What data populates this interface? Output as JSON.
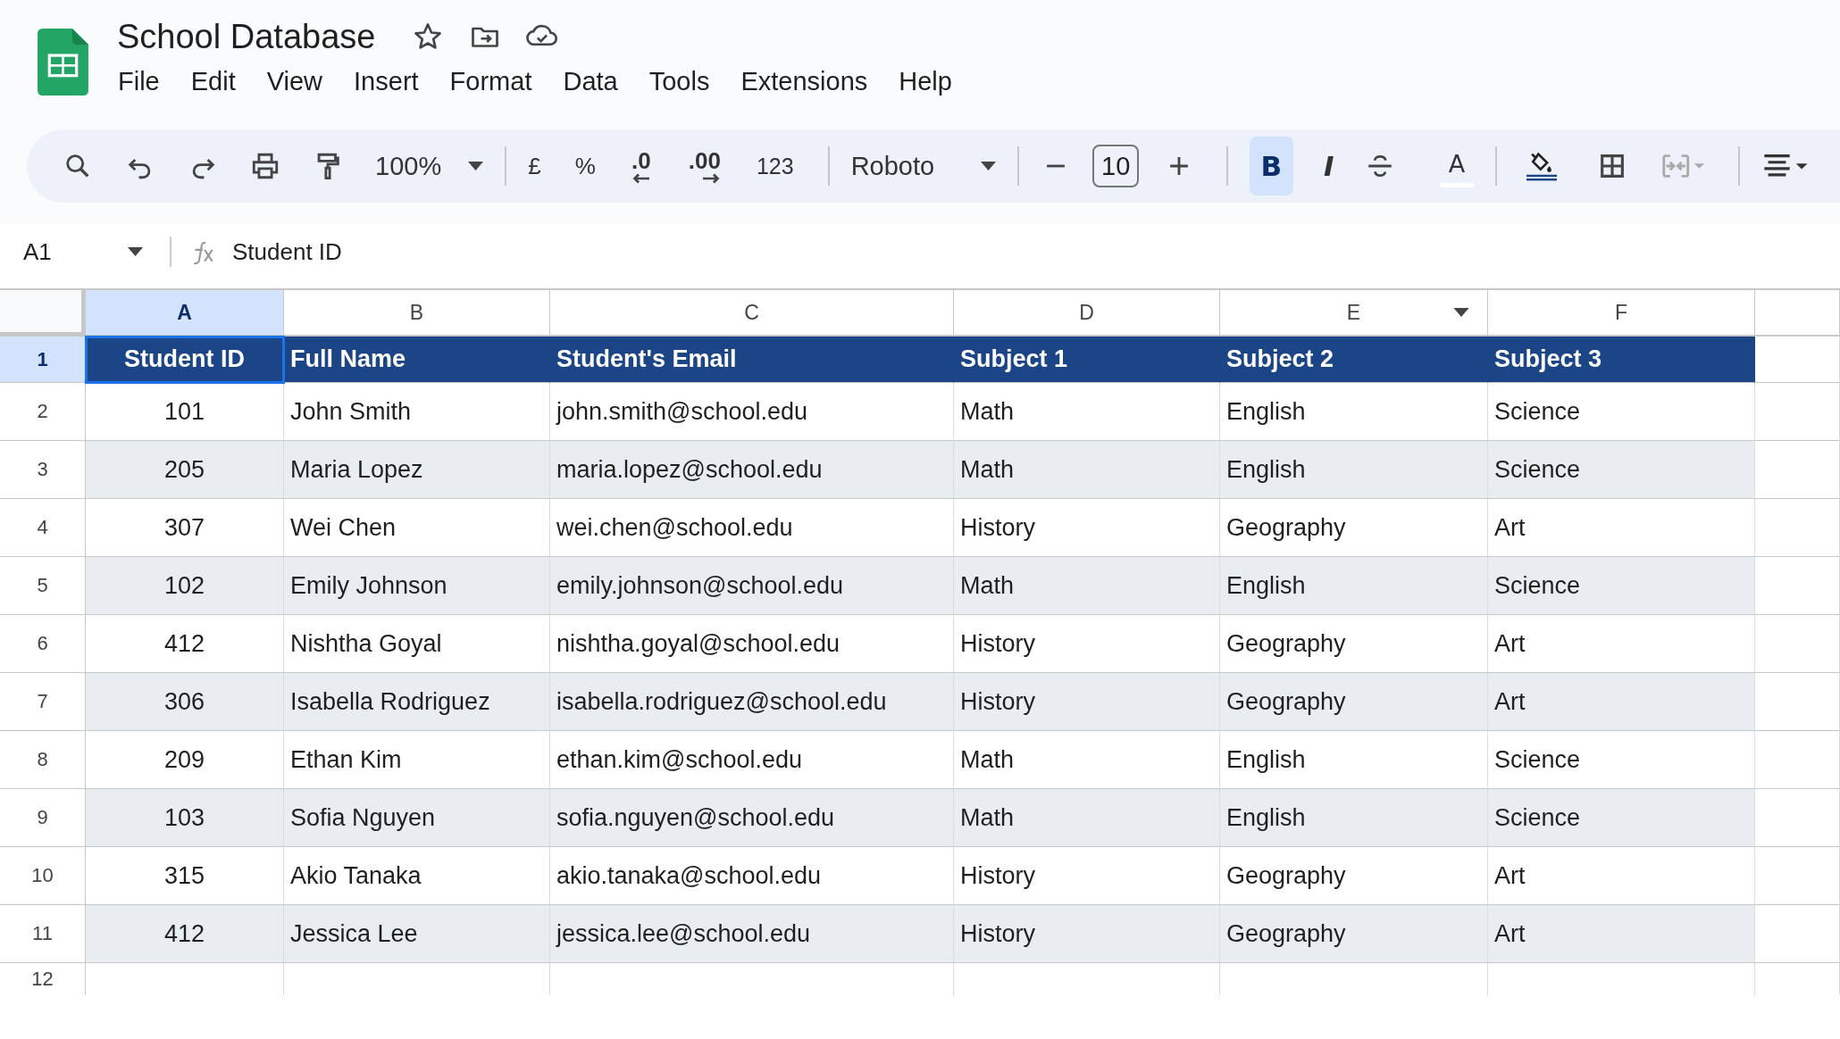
{
  "title": "School Database",
  "menu": [
    "File",
    "Edit",
    "View",
    "Insert",
    "Format",
    "Data",
    "Tools",
    "Extensions",
    "Help"
  ],
  "toolbar": {
    "zoom": "100%",
    "currency": "£",
    "percent": "%",
    "decrease_decimal": ".0",
    "increase_decimal": ".00",
    "number_format": "123",
    "font": "Roboto",
    "font_size": "10",
    "bold": {
      "label": "B",
      "selected": true
    },
    "italic": "I",
    "text_color": "A"
  },
  "name_box": "A1",
  "formula": "Student ID",
  "columns": [
    {
      "letter": "A",
      "selected": true,
      "filter": false
    },
    {
      "letter": "B",
      "selected": false,
      "filter": false
    },
    {
      "letter": "C",
      "selected": false,
      "filter": false
    },
    {
      "letter": "D",
      "selected": false,
      "filter": false
    },
    {
      "letter": "E",
      "selected": false,
      "filter": true
    },
    {
      "letter": "F",
      "selected": false,
      "filter": false
    }
  ],
  "rows": [
    {
      "number": "1",
      "selected": true,
      "kind": "header",
      "cells": [
        "Student ID",
        "Full Name",
        "Student's Email",
        "Subject 1",
        "Subject 2",
        "Subject 3"
      ]
    },
    {
      "number": "2",
      "selected": false,
      "kind": "data",
      "cells": [
        "101",
        "John Smith",
        "john.smith@school.edu",
        "Math",
        "English",
        "Science"
      ]
    },
    {
      "number": "3",
      "selected": false,
      "kind": "data",
      "cells": [
        "205",
        "Maria Lopez",
        "maria.lopez@school.edu",
        "Math",
        "English",
        "Science"
      ]
    },
    {
      "number": "4",
      "selected": false,
      "kind": "data",
      "cells": [
        "307",
        "Wei Chen",
        "wei.chen@school.edu",
        "History",
        "Geography",
        "Art"
      ]
    },
    {
      "number": "5",
      "selected": false,
      "kind": "data",
      "cells": [
        "102",
        "Emily Johnson",
        "emily.johnson@school.edu",
        "Math",
        "English",
        "Science"
      ]
    },
    {
      "number": "6",
      "selected": false,
      "kind": "data",
      "cells": [
        "412",
        "Nishtha Goyal",
        "nishtha.goyal@school.edu",
        "History",
        "Geography",
        "Art"
      ]
    },
    {
      "number": "7",
      "selected": false,
      "kind": "data",
      "cells": [
        "306",
        "Isabella Rodriguez",
        "isabella.rodriguez@school.edu",
        "History",
        "Geography",
        "Art"
      ]
    },
    {
      "number": "8",
      "selected": false,
      "kind": "data",
      "cells": [
        "209",
        "Ethan Kim",
        "ethan.kim@school.edu",
        "Math",
        "English",
        "Science"
      ]
    },
    {
      "number": "9",
      "selected": false,
      "kind": "data",
      "cells": [
        "103",
        "Sofia Nguyen",
        "sofia.nguyen@school.edu",
        "Math",
        "English",
        "Science"
      ]
    },
    {
      "number": "10",
      "selected": false,
      "kind": "data",
      "cells": [
        "315",
        "Akio Tanaka",
        "akio.tanaka@school.edu",
        "History",
        "Geography",
        "Art"
      ]
    },
    {
      "number": "11",
      "selected": false,
      "kind": "data",
      "cells": [
        "412",
        "Jessica Lee",
        "jessica.lee@school.edu",
        "History",
        "Geography",
        "Art"
      ]
    },
    {
      "number": "12",
      "selected": false,
      "kind": "empty",
      "cells": []
    }
  ]
}
